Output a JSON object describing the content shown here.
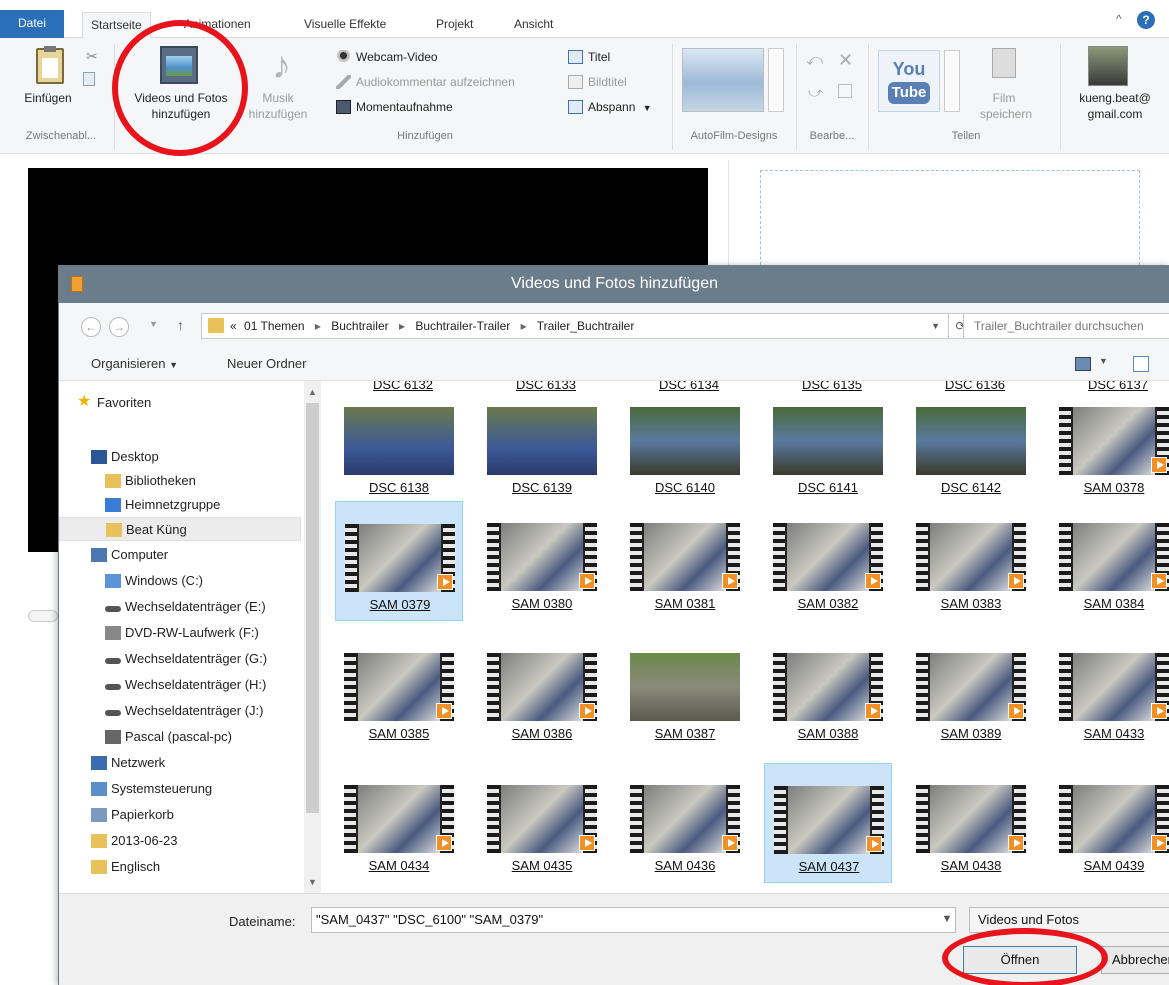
{
  "ribbon": {
    "tabs": [
      "Datei",
      "Startseite",
      "Animationen",
      "Visuelle Effekte",
      "Projekt",
      "Ansicht"
    ],
    "active_tab": "Startseite",
    "clipboard": {
      "paste_label": "Einfügen",
      "group_label": "Zwischenabl..."
    },
    "add": {
      "videos_photos_line1": "Videos und Fotos",
      "videos_photos_line2": "hinzufügen",
      "music_line1": "Musik",
      "music_line2": "hinzufügen",
      "webcam_video": "Webcam-Video",
      "audio_comment": "Audiokommentar aufzeichnen",
      "snapshot": "Momentaufnahme",
      "title": "Titel",
      "caption": "Bildtitel",
      "credits": "Abspann",
      "group_label": "Hinzufügen"
    },
    "autofilm_label": "AutoFilm-Designs",
    "edit_label": "Bearbe...",
    "share": {
      "youtube_line1": "You",
      "youtube_line2": "Tube",
      "save_movie_line1": "Film",
      "save_movie_line2": "speichern",
      "group_label": "Teilen"
    },
    "account": {
      "line1": "kueng.beat@",
      "line2": "gmail.com"
    },
    "help_icon": "?"
  },
  "dialog": {
    "title": "Videos und Fotos hinzufügen",
    "breadcrumb": [
      "«",
      "01 Themen",
      "Buchtrailer",
      "Buchtrailer-Trailer",
      "Trailer_Buchtrailer"
    ],
    "search_placeholder": "Trailer_Buchtrailer durchsuchen",
    "organize": "Organisieren",
    "new_folder": "Neuer Ordner",
    "nav_items": [
      {
        "label": "Favoriten",
        "icon": "star-icon"
      },
      {
        "label": "Desktop",
        "icon": "desktop-icon"
      },
      {
        "label": "Bibliotheken",
        "icon": "library-icon"
      },
      {
        "label": "Heimnetzgruppe",
        "icon": "homegroup-icon"
      },
      {
        "label": "Beat Küng",
        "icon": "user-folder-icon"
      },
      {
        "label": "Computer",
        "icon": "computer-icon"
      },
      {
        "label": "Windows (C:)",
        "icon": "windows-drive-icon"
      },
      {
        "label": "Wechseldatenträger (E:)",
        "icon": "removable-drive-icon"
      },
      {
        "label": "DVD-RW-Laufwerk (F:)",
        "icon": "dvd-drive-icon"
      },
      {
        "label": "Wechseldatenträger (G:)",
        "icon": "removable-drive-icon"
      },
      {
        "label": "Wechseldatenträger (H:)",
        "icon": "removable-drive-icon"
      },
      {
        "label": "Wechseldatenträger (J:)",
        "icon": "removable-drive-icon"
      },
      {
        "label": "Pascal (pascal-pc)",
        "icon": "network-pc-icon"
      },
      {
        "label": "Netzwerk",
        "icon": "network-icon"
      },
      {
        "label": "Systemsteuerung",
        "icon": "control-panel-icon"
      },
      {
        "label": "Papierkorb",
        "icon": "recycle-bin-icon"
      },
      {
        "label": "2013-06-23",
        "icon": "folder-icon"
      },
      {
        "label": "Englisch",
        "icon": "folder-icon"
      }
    ],
    "top_row": [
      "DSC 6132",
      "DSC 6133",
      "DSC 6134",
      "DSC 6135",
      "DSC 6136",
      "DSC 6137"
    ],
    "files": [
      [
        "DSC 6138",
        "DSC 6139",
        "DSC 6140",
        "DSC 6141",
        "DSC 6142",
        "SAM 0378"
      ],
      [
        "SAM 0379",
        "SAM 0380",
        "SAM 0381",
        "SAM 0382",
        "SAM 0383",
        "SAM 0384"
      ],
      [
        "SAM 0385",
        "SAM 0386",
        "SAM 0387",
        "SAM 0388",
        "SAM 0389",
        "SAM 0433"
      ],
      [
        "SAM 0434",
        "SAM 0435",
        "SAM 0436",
        "SAM 0437",
        "SAM 0438",
        "SAM 0439"
      ]
    ],
    "selected_files": [
      "SAM 0379",
      "SAM 0437"
    ],
    "filename_label": "Dateiname:",
    "filename_value": "\"SAM_0437\" \"DSC_6100\" \"SAM_0379\"",
    "filetype": "Videos und Fotos",
    "open_button": "Öffnen",
    "cancel_button": "Abbrechen"
  },
  "colors": {
    "accent": "#2a6fb8",
    "highlight_circle": "#e8131b",
    "titlebar": "#6b7c8b",
    "selection": "#cce4f7"
  }
}
